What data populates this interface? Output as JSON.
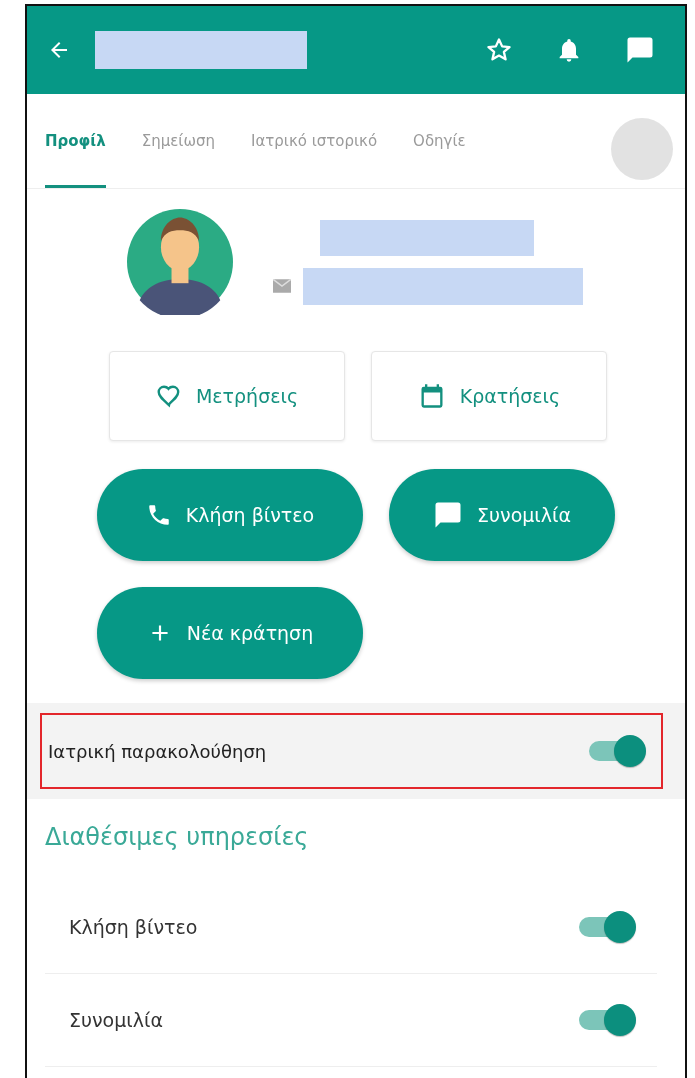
{
  "tabs": [
    {
      "label": "Προφίλ",
      "selected": true
    },
    {
      "label": "Σημείωση",
      "selected": false
    },
    {
      "label": "Ιατρικό ιστορικό",
      "selected": false
    },
    {
      "label": "Οδηγίε",
      "selected": false
    }
  ],
  "shortcuts": [
    {
      "kind": "heart",
      "label": "Μετρήσεις"
    },
    {
      "kind": "calendar",
      "label": "Κρατήσεις"
    }
  ],
  "actions": [
    {
      "kind": "phone",
      "label": "Κλήση βίντεο"
    },
    {
      "kind": "chat",
      "label": "Συνομιλία"
    },
    {
      "kind": "plus",
      "label": "Νέα κράτηση"
    }
  ],
  "monitoring": {
    "label": "Ιατρική παρακολούθηση",
    "on": true,
    "highlighted": true
  },
  "services": {
    "title": "Διαθέσιμες υπηρεσίες",
    "items": [
      {
        "label": "Κλήση βίντεο",
        "on": true
      },
      {
        "label": "Συνομιλία",
        "on": true
      }
    ]
  }
}
